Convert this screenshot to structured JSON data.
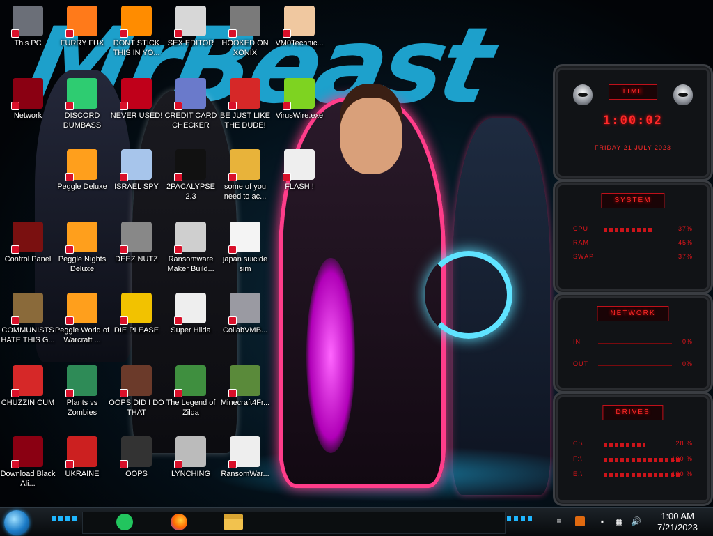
{
  "wallpaper": {
    "title": "MrBeast"
  },
  "desktop_icons": [
    {
      "label": "This PC",
      "icon": "this-pc-icon"
    },
    {
      "label": "FURRY FUX",
      "icon": "firefox-icon"
    },
    {
      "label": "DONT STICK THIS IN YO...",
      "icon": "vlc-cone-icon"
    },
    {
      "label": "SEX EDITOR",
      "icon": "hxd-editor-icon"
    },
    {
      "label": "HOOKED ON XONIX",
      "icon": "xonix-icon"
    },
    {
      "label": "VM0Technic...",
      "icon": "doctor-icon"
    },
    {
      "label": "Network",
      "icon": "alien-network-icon"
    },
    {
      "label": "DISCORD DUMBASS",
      "icon": "green-chat-icon"
    },
    {
      "label": "NEVER USED!",
      "icon": "dev-cpp-icon"
    },
    {
      "label": "CREDIT CARD CHECKER",
      "icon": "credit-card-icon"
    },
    {
      "label": "BE JUST LIKE THE DUDE!",
      "icon": "santa-icon"
    },
    {
      "label": "VirusWire.exe",
      "icon": "lime-icon"
    },
    {
      "label": "Peggle Deluxe",
      "icon": "peggle-icon"
    },
    {
      "label": "ISRAEL SPY",
      "icon": "remote-desktop-icon"
    },
    {
      "label": "2PACALYPSE 2.3",
      "icon": "terminal-icon"
    },
    {
      "label": "some of you need to ac...",
      "icon": "beaver-icon"
    },
    {
      "label": "FLASH !",
      "icon": "flash-file-icon"
    },
    {
      "label": "Control Panel",
      "icon": "control-panel-icon"
    },
    {
      "label": "Peggle Nights Deluxe",
      "icon": "peggle-icon"
    },
    {
      "label": "DEEZ NUTZ",
      "icon": "windows-stack-icon"
    },
    {
      "label": "Ransomware Maker Build...",
      "icon": "app-window-icon"
    },
    {
      "label": "japan suicide sim",
      "icon": "document-icon"
    },
    {
      "label": "COMMUNISTS HATE THIS G...",
      "icon": "money-bag-icon"
    },
    {
      "label": "Peggle World of Warcraft ...",
      "icon": "peggle-icon"
    },
    {
      "label": "DIE PLEASE",
      "icon": "adobe-de-icon"
    },
    {
      "label": "Super Hilda",
      "icon": "pixel-sprite-icon"
    },
    {
      "label": "CollabVMB...",
      "icon": "monitor-icon"
    },
    {
      "label": "CHUZZIN CUM",
      "icon": "chuzzle-icon"
    },
    {
      "label": "Plants vs Zombies",
      "icon": "plant-icon"
    },
    {
      "label": "OOPS DID I DO THAT",
      "icon": "portrait-icon"
    },
    {
      "label": "The Legend of Zilda",
      "icon": "link-sprite-icon"
    },
    {
      "label": "Minecraft4Fr...",
      "icon": "grass-block-icon"
    },
    {
      "label": "Download Black Ali...",
      "icon": "alien-network-icon"
    },
    {
      "label": "UKRAINE",
      "icon": "radiation-icon"
    },
    {
      "label": "OOPS",
      "icon": "book-icon"
    },
    {
      "label": "LYNCHING",
      "icon": "flag-house-icon"
    },
    {
      "label": "RansomWar...",
      "icon": "skull-icon"
    }
  ],
  "widgets": {
    "time": {
      "header": "TIME",
      "clock": "1:00:02",
      "date": "FRIDAY 21 JULY 2023"
    },
    "system": {
      "header": "SYSTEM",
      "rows": [
        {
          "key": "CPU",
          "value": "37%"
        },
        {
          "key": "RAM",
          "value": "45%"
        },
        {
          "key": "SWAP",
          "value": "37%"
        }
      ]
    },
    "network": {
      "header": "NETWORK",
      "rows": [
        {
          "key": "IN",
          "value": "0%"
        },
        {
          "key": "OUT",
          "value": "0%"
        }
      ]
    },
    "drives": {
      "header": "DRIVES",
      "rows": [
        {
          "key": "C:\\",
          "value": "28 %"
        },
        {
          "key": "F:\\",
          "value": "100 %"
        },
        {
          "key": "E:\\",
          "value": "100 %"
        }
      ]
    }
  },
  "taskbar": {
    "pinned": [
      "green-chat-icon",
      "firefox-icon",
      "file-explorer-icon"
    ],
    "tray": [
      "flag-icon",
      "power-icon",
      "network-icon",
      "speaker-icon"
    ],
    "time": "1:00 AM",
    "date": "7/21/2023"
  },
  "colors": {
    "accent": "#e0141a",
    "wallpaper_blue": "#1fa9d6",
    "pink": "#ff3d8a"
  }
}
